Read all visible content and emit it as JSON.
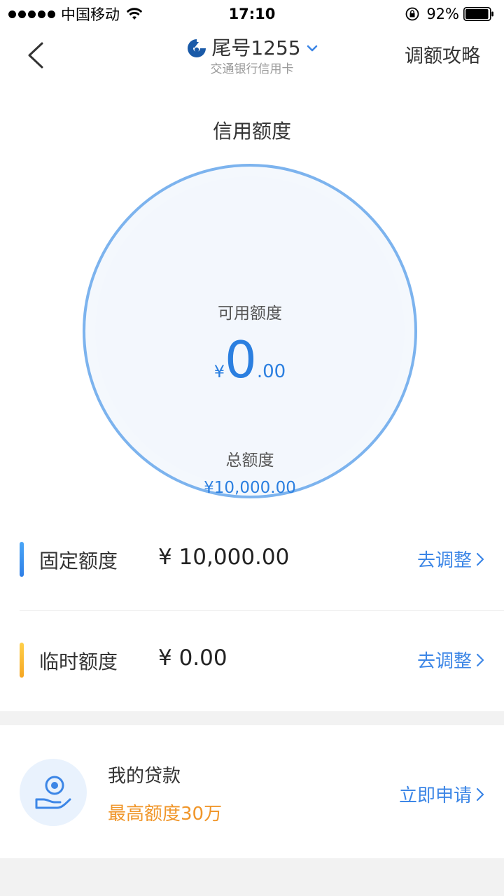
{
  "status_bar": {
    "carrier": "中国移动",
    "time": "17:10",
    "battery": "92%"
  },
  "nav": {
    "card_number": "尾号1255",
    "card_bank": "交通银行信用卡",
    "right_action": "调额攻略"
  },
  "credit": {
    "title": "信用额度",
    "available_label": "可用额度",
    "available_currency": "¥",
    "available_integer": "0",
    "available_decimal": ".00",
    "total_label": "总额度",
    "total_amount": "¥10,000.00"
  },
  "quotas": [
    {
      "name": "固定额度",
      "value": "¥ 10,000.00",
      "action": "去调整",
      "color": "#2f8cf0"
    },
    {
      "name": "临时额度",
      "value": "¥ 0.00",
      "action": "去调整",
      "color": "#f7b52b"
    }
  ],
  "loan": {
    "title": "我的贷款",
    "subtitle": "最高额度30万",
    "action": "立即申请"
  },
  "colors": {
    "accent": "#2b7fe0",
    "link": "#3c86e6",
    "loan_highlight": "#f0962a",
    "ring": "#7cb3ee"
  }
}
